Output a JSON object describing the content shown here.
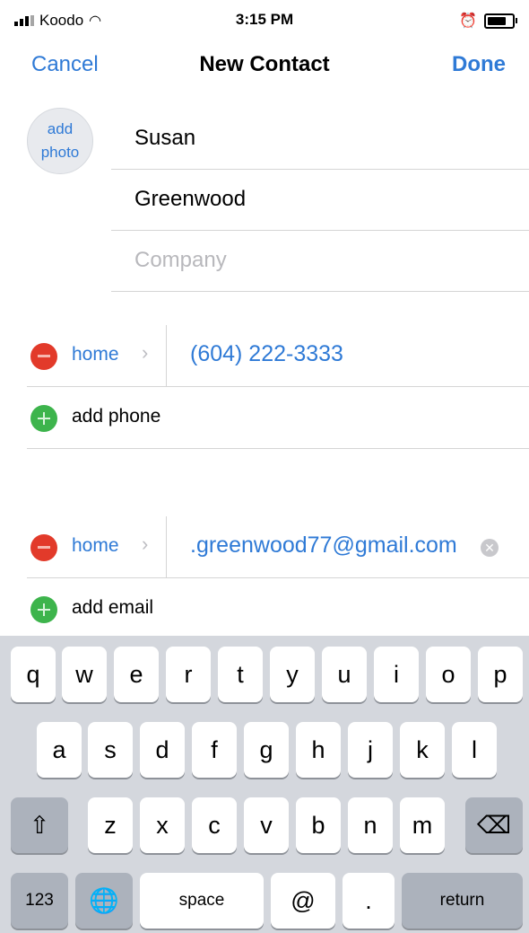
{
  "status": {
    "carrier": "Koodo",
    "time": "3:15 PM"
  },
  "nav": {
    "cancel": "Cancel",
    "title": "New Contact",
    "done": "Done"
  },
  "avatar": {
    "line1": "add",
    "line2": "photo"
  },
  "name": {
    "first": "Susan",
    "last": "Greenwood",
    "company_placeholder": "Company"
  },
  "phone": {
    "label": "home",
    "value": "(604) 222-3333",
    "add": "add phone"
  },
  "email": {
    "label": "home",
    "value": ".greenwood77@gmail.com",
    "add": "add email"
  },
  "keyboard": {
    "row1": [
      "q",
      "w",
      "e",
      "r",
      "t",
      "y",
      "u",
      "i",
      "o",
      "p"
    ],
    "row2": [
      "a",
      "s",
      "d",
      "f",
      "g",
      "h",
      "j",
      "k",
      "l"
    ],
    "row3": [
      "z",
      "x",
      "c",
      "v",
      "b",
      "n",
      "m"
    ],
    "num": "123",
    "space": "space",
    "at": "@",
    "dot": ".",
    "return": "return",
    "shift_glyph": "⇧",
    "globe_glyph": "🌐",
    "delete_glyph": "⌫"
  }
}
